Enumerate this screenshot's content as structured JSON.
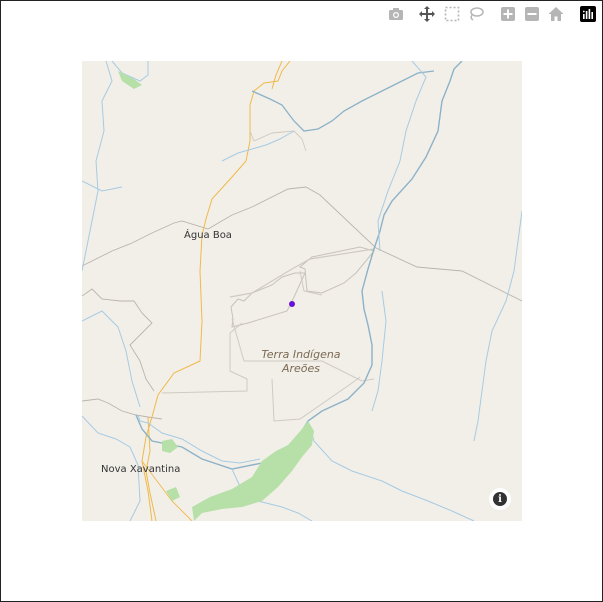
{
  "modebar": {
    "buttons": [
      {
        "name": "camera-icon",
        "title": "Download plot as a png"
      },
      {
        "name": "pan-icon",
        "title": "Pan"
      },
      {
        "name": "box-select-icon",
        "title": "Box Select"
      },
      {
        "name": "lasso-select-icon",
        "title": "Lasso Select"
      },
      {
        "name": "zoom-in-icon",
        "title": "Zoom in"
      },
      {
        "name": "zoom-out-icon",
        "title": "Zoom out"
      },
      {
        "name": "reset-view-icon",
        "title": "Reset view"
      },
      {
        "name": "plotly-logo-icon",
        "title": "Produced with Plotly"
      }
    ],
    "icon_color": "#b5b5b5",
    "logo_color": "#000000"
  },
  "map": {
    "labels": {
      "town1": "Água Boa",
      "town2": "Nova Xavantina",
      "area_line1": "Terra Indígena",
      "area_line2": "Areões"
    },
    "colors": {
      "land": "#f2efe9",
      "river": "#a6cbe3",
      "road": "#f0b94a",
      "boundary": "#b9b4ad",
      "reserve": "#d6d0c6",
      "forest": "#b7e0a8",
      "marker": "#6a11d8"
    }
  },
  "info_button": {
    "symbol": "i"
  }
}
